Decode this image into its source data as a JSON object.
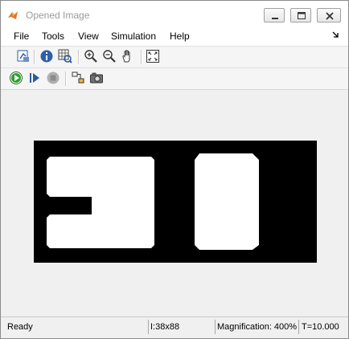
{
  "window": {
    "title": "Opened Image"
  },
  "menu": [
    "File",
    "Tools",
    "View",
    "Simulation",
    "Help"
  ],
  "toolbar1": {
    "icons": [
      "open-in-figure-icon",
      "info-icon",
      "pixel-region-icon",
      "zoom-in-icon",
      "zoom-out-icon",
      "pan-hand-icon",
      "fit-to-window-icon"
    ]
  },
  "toolbar2": {
    "icons": [
      "run-icon",
      "step-forward-icon",
      "stop-icon",
      "highlight-block-icon",
      "snapshot-camera-icon"
    ]
  },
  "status": {
    "state": "Ready",
    "image_info": "I:38x88",
    "magnification": "Magnification: 400%",
    "time": "T=10.000"
  },
  "colors": {
    "image_background": "#000000",
    "image_foreground": "#ffffff",
    "run_green": "#2e9e2e"
  }
}
